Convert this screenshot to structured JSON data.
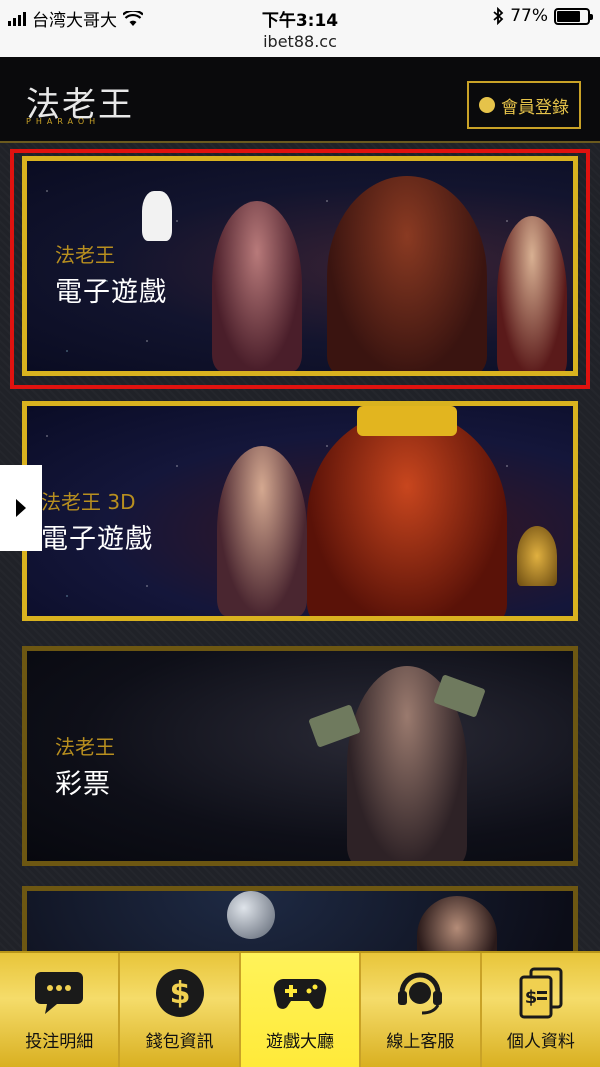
{
  "status_bar": {
    "carrier": "台湾大哥大",
    "time": "下午3:14",
    "battery_percent": "77%",
    "battery_level": 0.77,
    "url": "ibet88.cc"
  },
  "header": {
    "logo_text": "法老王",
    "logo_sub": "PHARAOH",
    "login_label": "會員登錄"
  },
  "cards": [
    {
      "sub": "法老王",
      "title": "電子遊戲"
    },
    {
      "sub": "法老王 3D",
      "title": "電子遊戲"
    },
    {
      "sub": "法老王",
      "title": "彩票"
    }
  ],
  "bottom_nav": [
    {
      "label": "投注明細",
      "icon": "chat-bubble-icon"
    },
    {
      "label": "錢包資訊",
      "icon": "dollar-icon"
    },
    {
      "label": "遊戲大廳",
      "icon": "gamepad-icon",
      "active": true
    },
    {
      "label": "線上客服",
      "icon": "headset-icon"
    },
    {
      "label": "個人資料",
      "icon": "documents-icon"
    }
  ],
  "colors": {
    "gold": "#d9b21f",
    "highlight_red": "#e0120f",
    "nav_active": "#ffea3a"
  }
}
